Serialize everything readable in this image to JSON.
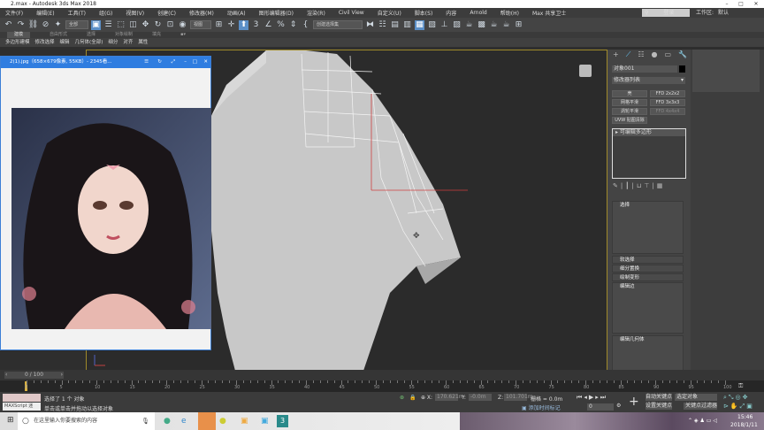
{
  "window": {
    "title": "2.max - Autodesk 3ds Max 2018",
    "minimize": "–",
    "maximize": "□",
    "close": "✕"
  },
  "menu": [
    "文件(F)",
    "编辑(E)",
    "工具(T)",
    "组(G)",
    "视图(V)",
    "创建(C)",
    "修改器(M)",
    "动画(A)",
    "图形编辑器(D)",
    "渲染(R)",
    "Civil View",
    "自定义(U)",
    "脚本(S)",
    "内容",
    "Arnold",
    "帮助(H)",
    "Max 共享卫士"
  ],
  "account": {
    "user": "登录",
    "workspace_label": "工作区:",
    "workspace_value": "默认"
  },
  "toolbar": {
    "filter": "全部",
    "ref_coord": "视图",
    "selection_set": "创建选择集"
  },
  "ribbon": {
    "tabs": [
      "建模",
      "自由形式",
      "选择",
      "对象绘制",
      "填充"
    ],
    "sub": [
      "多边形建模",
      "修改选择",
      "编辑",
      "几何体(全部)",
      "细分",
      "对齐",
      "属性"
    ]
  },
  "viewer": {
    "title": "2(1).jpg（658×679像素, 55KB）- 2345看..."
  },
  "command_panel": {
    "object_name": "对象001",
    "modifier_list": "修改器列表",
    "buttons": [
      "壳",
      "FFD 2x2x2",
      "网格平滑",
      "FFD 3x3x3",
      "涡轮平滑",
      "FFD 4x4x4",
      "UVW 贴图清除"
    ],
    "stack_item": "可编辑多边形",
    "rollouts": [
      "选择",
      "软选择",
      "细分置换",
      "绘制变形",
      "编辑边",
      "编辑几何体"
    ]
  },
  "timeline": {
    "frame": "0 / 100",
    "ticks": [
      "0",
      "5",
      "10",
      "15",
      "20",
      "25",
      "30",
      "35",
      "40",
      "45",
      "50",
      "55",
      "60",
      "65",
      "70",
      "75",
      "80",
      "85",
      "90",
      "95",
      "100"
    ]
  },
  "status": {
    "maxscript": "MAXScript 迷",
    "selected": "选择了 1 个 对象",
    "prompt": "单击或单击并拖动以选择对象",
    "x": "170.621m",
    "y": "-0.0m",
    "z": "101.701m",
    "grid": "栅格 = 0.0m",
    "time_tag": "添加时间标记",
    "auto_key": "自动关键点",
    "set_key": "设置关键点",
    "selected_obj": "选定对象",
    "key_filters": "关键点过滤器",
    "frame_field": "0"
  },
  "taskbar": {
    "search": "在这里输入你要搜索的内容",
    "time": "15:46",
    "date": "2018/1/11"
  }
}
